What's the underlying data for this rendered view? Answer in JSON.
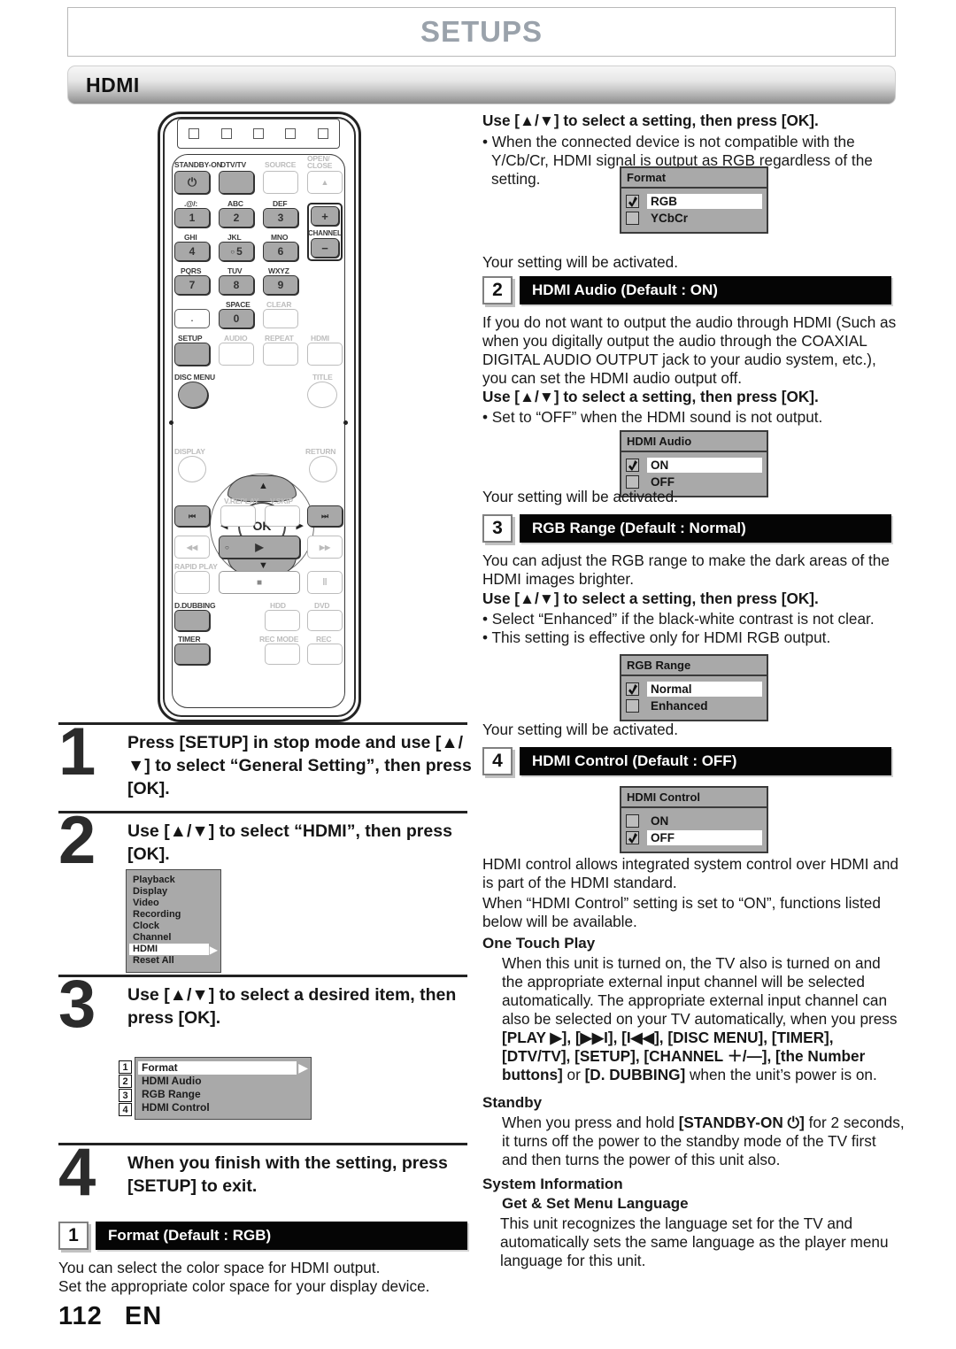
{
  "page": {
    "title": "SETUPS",
    "section_banner": "HDMI",
    "page_number": "112",
    "page_lang": "EN"
  },
  "remote": {
    "top_indicator_count": 5,
    "labels": {
      "standby_on": "STANDBY-ON",
      "dtv_tv": "DTV/TV",
      "source": "SOURCE",
      "open_close": "OPEN/\nCLOSE",
      "k1": ".@/:",
      "k2": "ABC",
      "k3": "DEF",
      "k4": "GHI",
      "k5": "JKL",
      "k6": "MNO",
      "k7": "PQRS",
      "k8": "TUV",
      "k9": "WXYZ",
      "k0": "SPACE",
      "clear": "CLEAR",
      "channel": "CHANNEL",
      "setup": "SETUP",
      "audio": "AUDIO",
      "repeat": "REPEAT",
      "hdmi": "HDMI",
      "disc_menu": "DISC MENU",
      "title": "TITLE",
      "display": "DISPLAY",
      "return": "RETURN",
      "v_replay": "V.REPLAY",
      "v_skip": "V.SKIP",
      "rapid_play": "RAPID PLAY",
      "d_dubbing": "D.DUBBING",
      "hdd": "HDD",
      "dvd": "DVD",
      "timer": "TIMER",
      "rec_mode": "REC MODE",
      "rec": "REC",
      "ok": "OK"
    },
    "keys": {
      "n1": "1",
      "n2": "2",
      "n3": "3",
      "n4": "4",
      "n5": "5",
      "n6": "6",
      "n7": "7",
      "n8": "8",
      "n9": "9",
      "n0": "0",
      "dot": ".",
      "ch_plus": "+",
      "ch_minus": "−",
      "eject": "▲",
      "power": "⏻",
      "prev": "⏮",
      "next": "⏭",
      "rew": "◀◀",
      "ff": "▶▶",
      "play": "▶",
      "stop": "■",
      "pause": "‖"
    }
  },
  "steps": [
    {
      "number": "1",
      "text": "Press [SETUP] in stop mode and use [▲/▼] to select “General Setting”, then press [OK]."
    },
    {
      "number": "2",
      "text": "Use [▲/▼] to select “HDMI”, then press [OK]."
    },
    {
      "number": "3",
      "text": "Use [▲/▼] to select a desired item, then press [OK]."
    },
    {
      "number": "4",
      "text": "When you finish with the setting, press [SETUP] to exit."
    }
  ],
  "general_setting_menu": {
    "items": [
      "Playback",
      "Display",
      "Video",
      "Recording",
      "Clock",
      "Channel",
      "HDMI",
      "Reset All"
    ],
    "selected": "HDMI"
  },
  "hdmi_menu": {
    "items": [
      {
        "num": "1",
        "label": "Format"
      },
      {
        "num": "2",
        "label": "HDMI Audio"
      },
      {
        "num": "3",
        "label": "RGB Range"
      },
      {
        "num": "4",
        "label": "HDMI Control"
      }
    ],
    "selected": "Format"
  },
  "sections": {
    "format": {
      "num": "1",
      "heading": "Format (Default : RGB)",
      "body1": "You can select the color space for HDMI output.",
      "body2": "Set the appropriate color space for your display device.",
      "instruction": "Use [▲/▼] to select a setting, then press [OK].",
      "bullet1": "• When the connected device is not compatible with the Y/Cb/Cr, HDMI signal is output as RGB regardless of the setting.",
      "dialog": {
        "title": "Format",
        "options": [
          {
            "label": "RGB",
            "checked": true
          },
          {
            "label": "YCbCr",
            "checked": false
          }
        ]
      },
      "activated": "Your setting will be activated."
    },
    "hdmi_audio": {
      "num": "2",
      "heading": "HDMI Audio (Default : ON)",
      "body": "If you do not want to output the audio through HDMI (Such as when you digitally output the audio through the COAXIAL DIGITAL AUDIO OUTPUT jack to your audio system, etc.), you can set the HDMI audio output off.",
      "instruction": "Use [▲/▼] to select a setting, then press [OK].",
      "bullet1": "• Set to “OFF” when the HDMI sound is not output.",
      "dialog": {
        "title": "HDMI Audio",
        "options": [
          {
            "label": "ON",
            "checked": true
          },
          {
            "label": "OFF",
            "checked": false
          }
        ]
      },
      "activated": "Your setting will be activated."
    },
    "rgb_range": {
      "num": "3",
      "heading": "RGB Range (Default : Normal)",
      "body": "You can adjust the RGB range to make the dark areas of the HDMI images brighter.",
      "instruction": "Use [▲/▼] to select a setting, then press [OK].",
      "bullet1": "• Select “Enhanced” if the black-white contrast is not clear.",
      "bullet2": "• This setting is effective only for HDMI RGB output.",
      "dialog": {
        "title": "RGB Range",
        "options": [
          {
            "label": "Normal",
            "checked": true
          },
          {
            "label": "Enhanced",
            "checked": false
          }
        ]
      },
      "activated": "Your setting will be activated."
    },
    "hdmi_control": {
      "num": "4",
      "heading": "HDMI Control (Default : OFF)",
      "dialog": {
        "title": "HDMI Control",
        "options": [
          {
            "label": "ON",
            "checked": false
          },
          {
            "label": "OFF",
            "checked": true
          }
        ]
      },
      "body1": "HDMI control allows integrated system control over HDMI and is part of the HDMI standard.",
      "body2": "When “HDMI Control” setting is set to “ON”, functions listed below will be available.",
      "one_touch_play": {
        "heading": "One Touch Play",
        "text_a": "When this unit is turned on, the TV also is turned on and the appropriate external input channel will be selected automatically. The appropriate external input channel can also be selected on your TV automatically, when you press ",
        "keys_a": "[PLAY ▶], [▶▶I], [I◀◀], [DISC MENU], [TIMER], [DTV/TV], [SETUP], [CHANNEL ＋/—], [the Number buttons]",
        "text_b": " or ",
        "keys_b": "[D. DUBBING]",
        "text_c": " when the unit’s power is on."
      },
      "standby": {
        "heading": "Standby",
        "text_a": "When you press and hold ",
        "keys_a": "[STANDBY-ON ⏻]",
        "text_b": " for 2 seconds, it turns off the power to the standby mode of the TV first and then turns the power of this unit also."
      },
      "system_information": {
        "heading": "System Information",
        "sub_heading": "Get & Set Menu Language",
        "text": "This unit recognizes the language set for the TV and automatically sets the same language as the player menu language for this unit."
      }
    }
  }
}
